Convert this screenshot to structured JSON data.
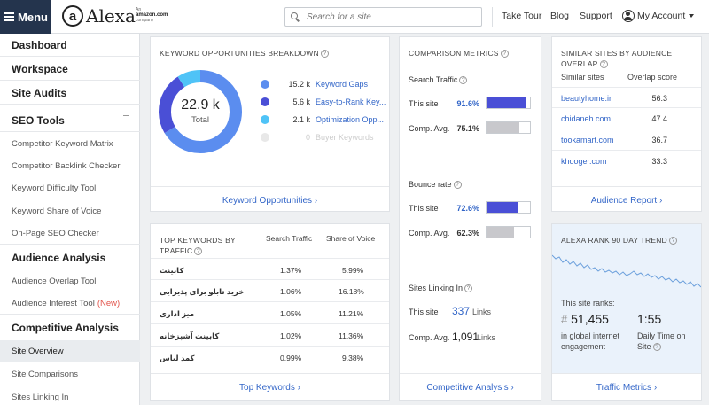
{
  "header": {
    "menu_label": "Menu",
    "logo_mark": "a",
    "logo_text": "Alexa",
    "amazon_line1": "An",
    "amazon_line2": "amazon.com",
    "amazon_line3": "company",
    "search_placeholder": "Search for a site",
    "nav": [
      "Take Tour",
      "Blog",
      "Support"
    ],
    "account_label": "My Account"
  },
  "sidebar": {
    "dashboard": "Dashboard",
    "workspace": "Workspace",
    "site_audits": "Site Audits",
    "seo_tools": "SEO Tools",
    "seo_items": [
      "Competitor Keyword Matrix",
      "Competitor Backlink Checker",
      "Keyword Difficulty Tool",
      "Keyword Share of Voice",
      "On-Page SEO Checker"
    ],
    "audience_analysis": "Audience Analysis",
    "audience_items": [
      "Audience Overlap Tool",
      "Audience Interest Tool"
    ],
    "new_tag": "(New)",
    "competitive_analysis": "Competitive Analysis",
    "competitive_items": [
      "Site Overview",
      "Site Comparisons",
      "Sites Linking In"
    ]
  },
  "keyword_opps": {
    "title": "KEYWORD OPPORTUNITIES BREAKDOWN",
    "total_value": "22.9 k",
    "total_label": "Total",
    "legend": [
      {
        "value": "15.2 k",
        "label": "Keyword Gaps",
        "color": "#5b8def"
      },
      {
        "value": "5.6 k",
        "label": "Easy-to-Rank Key...",
        "color": "#4a4fd6"
      },
      {
        "value": "2.1 k",
        "label": "Optimization Opp...",
        "color": "#4fc3f7"
      },
      {
        "value": "0",
        "label": "Buyer Keywords",
        "color": "#e8e8e8"
      }
    ],
    "link": "Keyword Opportunities ›"
  },
  "top_keywords": {
    "title_line1": "TOP KEYWORDS BY",
    "title_line2": "TRAFFIC",
    "col_traffic": "Search Traffic",
    "col_sov": "Share of Voice",
    "rows": [
      {
        "keyword": "کابینت",
        "traffic": "1.37%",
        "sov": "5.99%"
      },
      {
        "keyword": "خرید تابلو برای پذیرایی",
        "traffic": "1.06%",
        "sov": "16.18%"
      },
      {
        "keyword": "میز اداری",
        "traffic": "1.05%",
        "sov": "11.21%"
      },
      {
        "keyword": "کابینت آشپزخانه",
        "traffic": "1.02%",
        "sov": "11.36%"
      },
      {
        "keyword": "کمد لباس",
        "traffic": "0.99%",
        "sov": "9.38%"
      }
    ],
    "link": "Top Keywords ›"
  },
  "comparison": {
    "title": "COMPARISON METRICS",
    "search_traffic_label": "Search Traffic",
    "bounce_label": "Bounce rate",
    "this_site": "This site",
    "comp_avg": "Comp. Avg.",
    "search_this": "91.6%",
    "search_this_frac": 0.916,
    "search_comp": "75.1%",
    "search_comp_frac": 0.751,
    "bounce_this": "72.6%",
    "bounce_this_frac": 0.726,
    "bounce_comp": "62.3%",
    "bounce_comp_frac": 0.623,
    "linking_label": "Sites Linking In",
    "linking_this": "337",
    "linking_comp": "1,091",
    "links_word": "Links",
    "link": "Competitive Analysis ›",
    "this_color": "#4a4fd6",
    "comp_color": "#c8c8cc"
  },
  "similar": {
    "title_line1": "SIMILAR SITES BY AUDIENCE",
    "title_line2": "OVERLAP",
    "col_sites": "Similar sites",
    "col_score": "Overlap score",
    "rows": [
      {
        "site": "beautyhome.ir",
        "score": "56.3"
      },
      {
        "site": "chidaneh.com",
        "score": "47.4"
      },
      {
        "site": "tookamart.com",
        "score": "36.7"
      },
      {
        "site": "khooger.com",
        "score": "33.3"
      }
    ],
    "link": "Audience Report ›"
  },
  "rank": {
    "title": "ALEXA RANK 90 DAY TREND",
    "ranks_label": "This site ranks:",
    "rank_value": "51,455",
    "rank_caption": "in global internet engagement",
    "time_value": "1:55",
    "time_caption": "Daily Time on Site",
    "link": "Traffic Metrics ›",
    "trend_color": "#6ca0dc"
  }
}
